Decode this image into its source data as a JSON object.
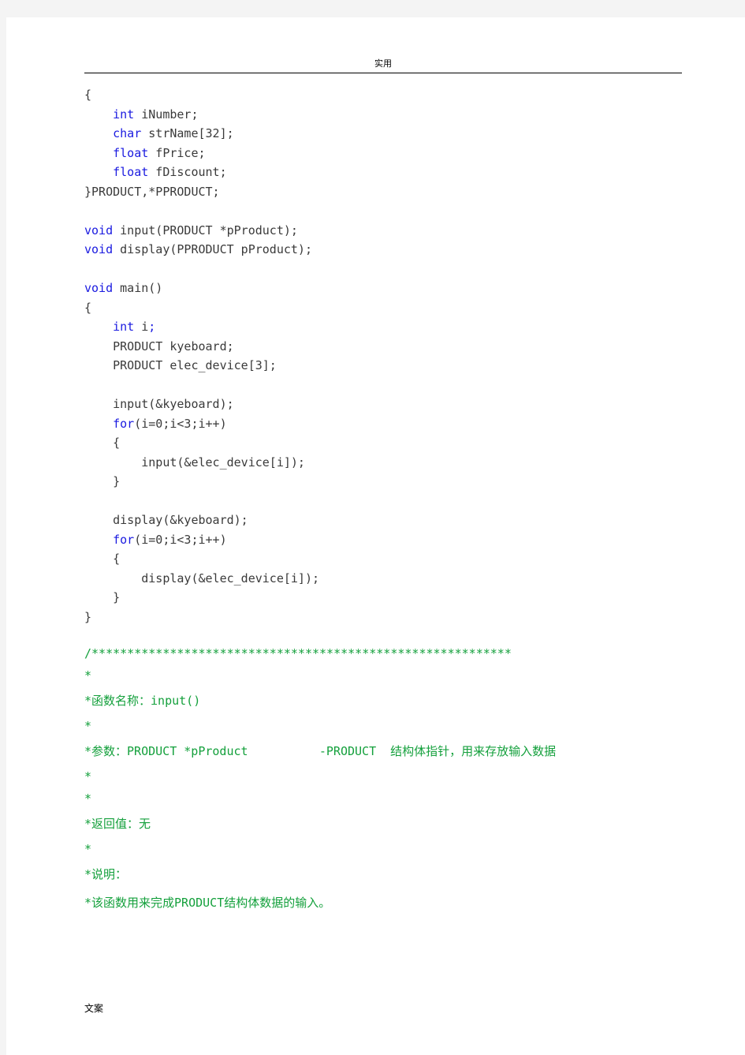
{
  "page": {
    "header_text": "实用",
    "footer_text": "文案",
    "background_color": "#f4f4f4",
    "page_color": "#ffffff"
  },
  "colors": {
    "keyword": "#1a1ae0",
    "comment": "#14a03c",
    "text": "#262626"
  },
  "code": {
    "lines": [
      {
        "indent": 0,
        "segments": [
          {
            "t": "{",
            "c": "plain"
          }
        ]
      },
      {
        "indent": 1,
        "segments": [
          {
            "t": "int",
            "c": "kw"
          },
          {
            "t": " iNumber;",
            "c": "plain"
          }
        ]
      },
      {
        "indent": 1,
        "segments": [
          {
            "t": "char",
            "c": "kw"
          },
          {
            "t": " strName[32];",
            "c": "plain"
          }
        ]
      },
      {
        "indent": 1,
        "segments": [
          {
            "t": "float",
            "c": "kw"
          },
          {
            "t": " fPrice;",
            "c": "plain"
          }
        ]
      },
      {
        "indent": 1,
        "segments": [
          {
            "t": "float",
            "c": "kw"
          },
          {
            "t": " fDiscount;",
            "c": "plain"
          }
        ]
      },
      {
        "indent": 0,
        "segments": [
          {
            "t": "}PRODUCT,*PPRODUCT;",
            "c": "plain"
          }
        ]
      },
      {
        "indent": 0,
        "segments": [
          {
            "t": "",
            "c": "plain"
          }
        ]
      },
      {
        "indent": 0,
        "segments": [
          {
            "t": "void",
            "c": "kw"
          },
          {
            "t": " input(PRODUCT *pProduct);",
            "c": "plain"
          }
        ]
      },
      {
        "indent": 0,
        "segments": [
          {
            "t": "void",
            "c": "kw"
          },
          {
            "t": " display(PPRODUCT pProduct);",
            "c": "plain"
          }
        ]
      },
      {
        "indent": 0,
        "segments": [
          {
            "t": "",
            "c": "plain"
          }
        ]
      },
      {
        "indent": 0,
        "segments": [
          {
            "t": "void",
            "c": "kw"
          },
          {
            "t": " main()",
            "c": "plain"
          }
        ]
      },
      {
        "indent": 0,
        "segments": [
          {
            "t": "{",
            "c": "plain"
          }
        ]
      },
      {
        "indent": 1,
        "segments": [
          {
            "t": "int",
            "c": "kw"
          },
          {
            "t": " i",
            "c": "plain"
          },
          {
            "t": ";",
            "c": "blue"
          }
        ]
      },
      {
        "indent": 1,
        "segments": [
          {
            "t": "PRODUCT kyeboard;",
            "c": "plain"
          }
        ]
      },
      {
        "indent": 1,
        "segments": [
          {
            "t": "PRODUCT elec_device[3];",
            "c": "plain"
          }
        ]
      },
      {
        "indent": 0,
        "segments": [
          {
            "t": "",
            "c": "plain"
          }
        ]
      },
      {
        "indent": 1,
        "segments": [
          {
            "t": "input(&kyeboard);",
            "c": "plain"
          }
        ]
      },
      {
        "indent": 1,
        "segments": [
          {
            "t": "for",
            "c": "kw"
          },
          {
            "t": "(i=0;i<3;i++)",
            "c": "plain"
          }
        ]
      },
      {
        "indent": 1,
        "segments": [
          {
            "t": "{",
            "c": "plain"
          }
        ]
      },
      {
        "indent": 2,
        "segments": [
          {
            "t": "input(&elec_device[i]);",
            "c": "plain"
          }
        ]
      },
      {
        "indent": 1,
        "segments": [
          {
            "t": "}",
            "c": "plain"
          }
        ]
      },
      {
        "indent": 0,
        "segments": [
          {
            "t": "",
            "c": "plain"
          }
        ]
      },
      {
        "indent": 1,
        "segments": [
          {
            "t": "display(&kyeboard);",
            "c": "plain"
          }
        ]
      },
      {
        "indent": 1,
        "segments": [
          {
            "t": "for",
            "c": "kw"
          },
          {
            "t": "(i=0;i<3;i++)",
            "c": "plain"
          }
        ]
      },
      {
        "indent": 1,
        "segments": [
          {
            "t": "{",
            "c": "plain"
          }
        ]
      },
      {
        "indent": 2,
        "segments": [
          {
            "t": "display(&elec_device[i]);",
            "c": "plain"
          }
        ]
      },
      {
        "indent": 1,
        "segments": [
          {
            "t": "}",
            "c": "plain"
          }
        ]
      },
      {
        "indent": 0,
        "segments": [
          {
            "t": "}",
            "c": "plain"
          }
        ]
      }
    ]
  },
  "comment_block": {
    "lines": [
      {
        "text": "/***********************************************************",
        "style": "stars"
      },
      {
        "text": "*",
        "style": "thin"
      },
      {
        "text": "*函数名称：input()",
        "style": "normal"
      },
      {
        "text": "*",
        "style": "thin"
      },
      {
        "text": "*参数：PRODUCT *pProduct          -PRODUCT  结构体指针，用来存放输入数据",
        "style": "normal"
      },
      {
        "text": "*",
        "style": "thin"
      },
      {
        "text": "*",
        "style": "thin"
      },
      {
        "text": "*返回值：无",
        "style": "normal"
      },
      {
        "text": "*",
        "style": "thin"
      },
      {
        "text": "*说明：",
        "style": "normal"
      },
      {
        "text": "*该函数用来完成PRODUCT结构体数据的输入。",
        "style": "normal"
      }
    ]
  }
}
